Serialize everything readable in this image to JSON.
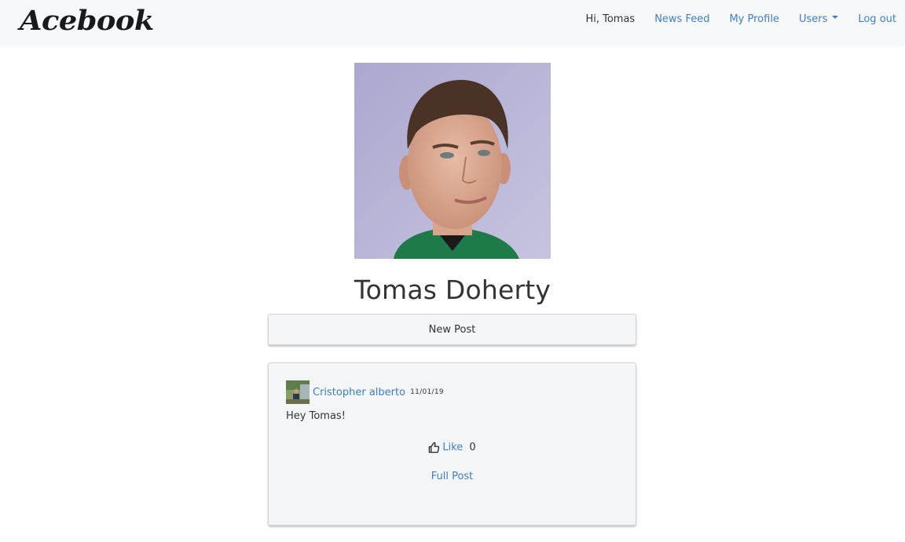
{
  "navbar": {
    "brand": "Acebook",
    "greeting": "Hi, Tomas",
    "links": [
      {
        "label": "News Feed"
      },
      {
        "label": "My Profile"
      },
      {
        "label": "Users",
        "dropdown": true
      },
      {
        "label": "Log out"
      }
    ]
  },
  "profile": {
    "name": "Tomas Doherty",
    "photo_alt": "Tomas Doherty profile photo"
  },
  "actions": {
    "new_post_label": "New Post"
  },
  "posts": [
    {
      "author": "Cristopher alberto",
      "date": "11/01/19",
      "body": "Hey Tomas!",
      "like_label": "Like",
      "like_count": "0",
      "full_post_label": "Full Post",
      "avatar_alt": "Cristopher alberto avatar"
    }
  ],
  "icons": {
    "like": "thumbs-up-outline"
  },
  "colors": {
    "link": "#3f7fbf",
    "navbar_bg": "#f7f8fa",
    "card_bg": "#f4f5f7",
    "text": "#333333"
  }
}
